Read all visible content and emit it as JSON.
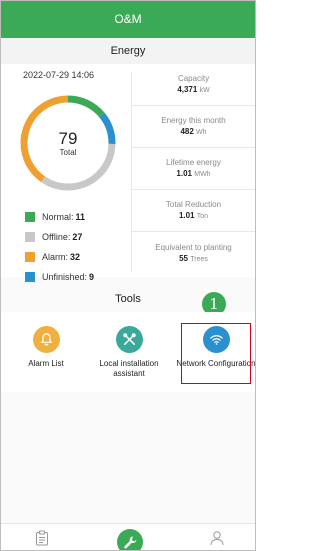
{
  "header": {
    "title": "O&M"
  },
  "energy": {
    "section_title": "Energy",
    "datetime": "2022-07-29 14:06",
    "total": {
      "value": "79",
      "label": "Total"
    },
    "legend": [
      {
        "label": "Normal:",
        "value": "11",
        "color": "#3aaa57",
        "count": 11
      },
      {
        "label": "Offline:",
        "value": "27",
        "color": "#c8c8c8",
        "count": 27
      },
      {
        "label": "Alarm:",
        "value": "32",
        "color": "#f0a030",
        "count": 32
      },
      {
        "label": "Unfinished:",
        "value": "9",
        "color": "#2a90d0",
        "count": 9
      }
    ],
    "stats": [
      {
        "label": "Capacity",
        "value": "4,371",
        "unit": "kW"
      },
      {
        "label": "Energy this month",
        "value": "482",
        "unit": "Wh"
      },
      {
        "label": "Lifetime energy",
        "value": "1.01",
        "unit": "MWh"
      },
      {
        "label": "Total Reduction",
        "value": "1.01",
        "unit": "Ton"
      },
      {
        "label": "Equivalent to planting",
        "value": "55",
        "unit": "Trees"
      }
    ]
  },
  "tools": {
    "section_title": "Tools",
    "items": [
      {
        "label": "Alarm List",
        "icon": "bell-icon",
        "color": "#f0b040"
      },
      {
        "label": "Local installation assistant",
        "icon": "tools-icon",
        "color": "#3aa89a"
      },
      {
        "label": "Network Configuration",
        "icon": "wifi-icon",
        "color": "#2a90d0"
      }
    ]
  },
  "annotation": {
    "step_number": "1"
  },
  "bottom_nav": {
    "items": [
      {
        "icon": "clipboard-icon"
      },
      {
        "icon": "wrench-icon",
        "active": true
      },
      {
        "icon": "user-icon"
      }
    ]
  }
}
